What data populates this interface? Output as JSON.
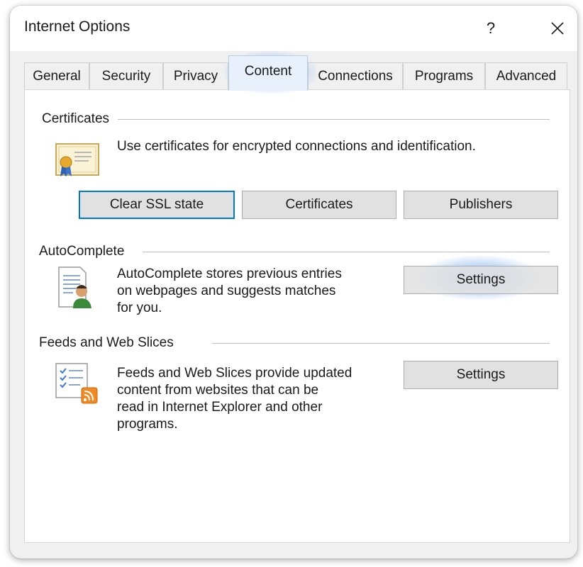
{
  "window": {
    "title": "Internet Options",
    "help_label": "?",
    "close_icon": "close-icon"
  },
  "tabs": [
    {
      "label": "General"
    },
    {
      "label": "Security"
    },
    {
      "label": "Privacy"
    },
    {
      "label": "Content",
      "active": true
    },
    {
      "label": "Connections"
    },
    {
      "label": "Programs"
    },
    {
      "label": "Advanced"
    }
  ],
  "certificates": {
    "group_label": "Certificates",
    "description": "Use certificates for encrypted connections and identification.",
    "icon": "certificate-icon",
    "buttons": {
      "clear_ssl": "Clear SSL state",
      "certificates": "Certificates",
      "publishers": "Publishers"
    }
  },
  "autocomplete": {
    "group_label": "AutoComplete",
    "description_lines": [
      "AutoComplete stores previous entries",
      "on webpages and suggests matches",
      "for you."
    ],
    "icon": "autocomplete-icon",
    "settings_label": "Settings"
  },
  "feeds": {
    "group_label": "Feeds and Web Slices",
    "description_lines": [
      "Feeds and Web Slices provide updated",
      "content from websites that can be",
      "read in Internet Explorer and other",
      "programs."
    ],
    "icon": "feeds-icon",
    "settings_label": "Settings"
  },
  "colors": {
    "accent": "#0078d7",
    "button_face": "#e1e1e1",
    "highlight_glow": "#8cb9f0"
  }
}
